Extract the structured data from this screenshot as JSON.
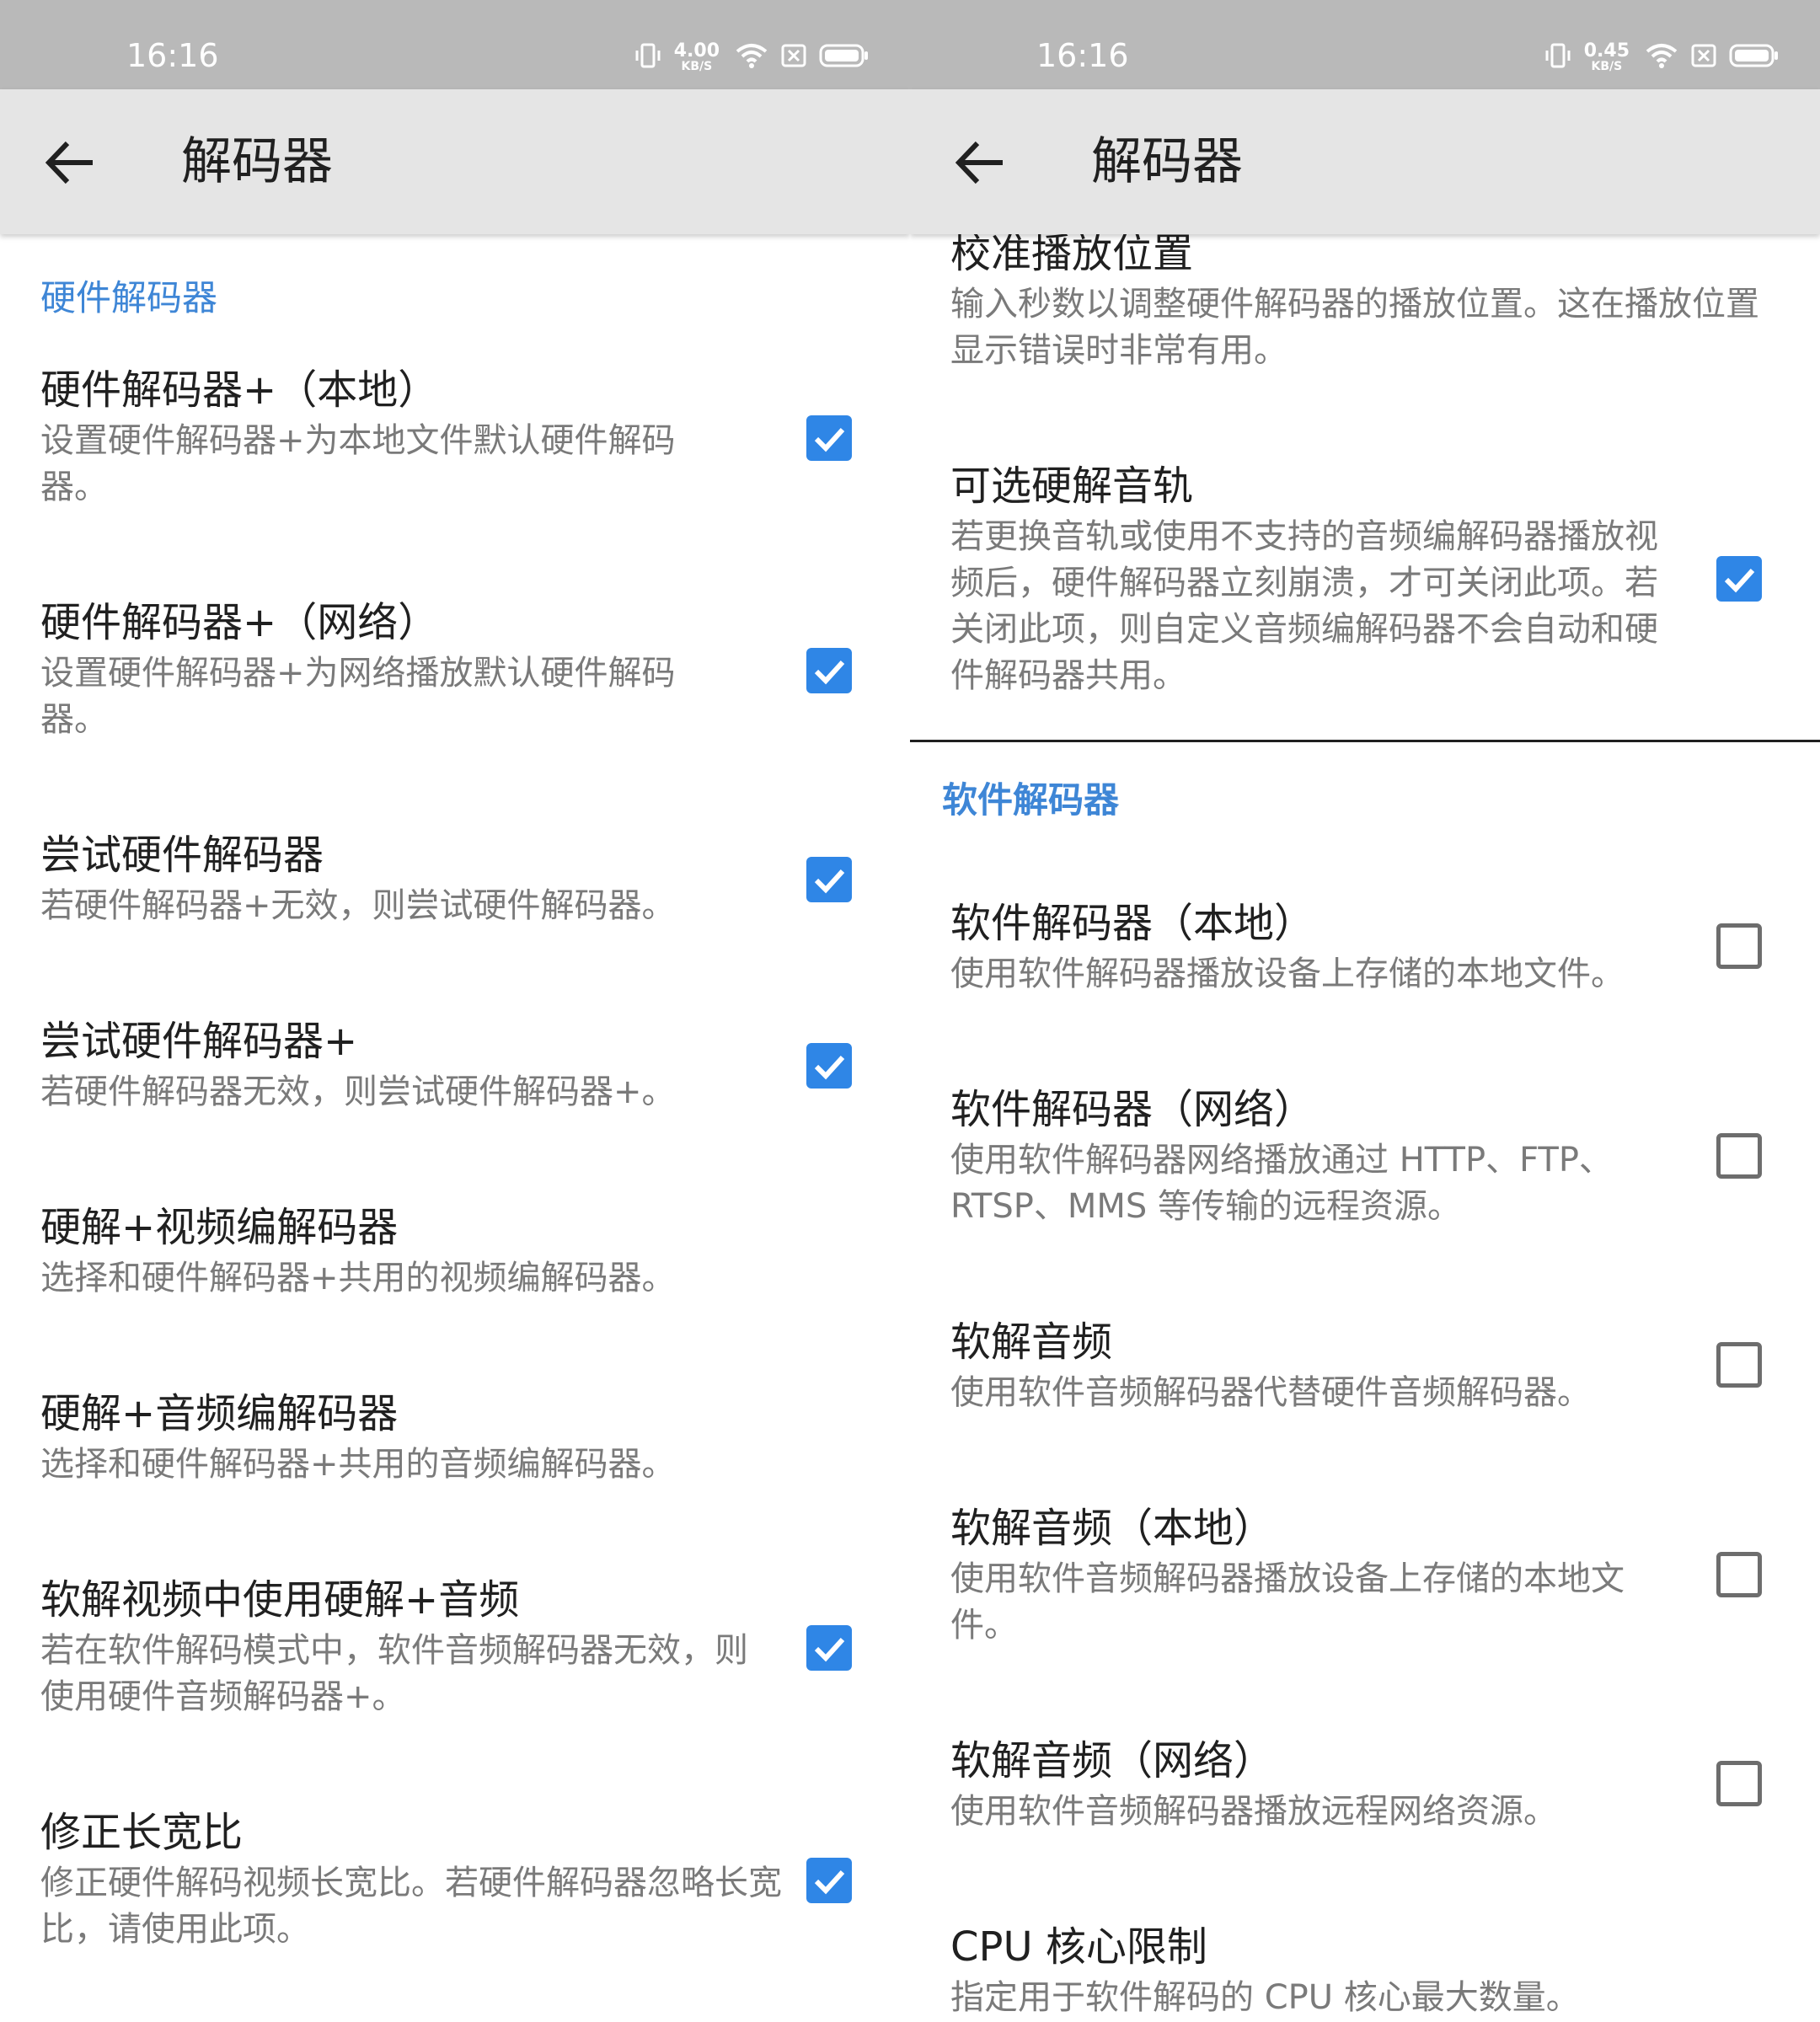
{
  "left": {
    "status_bar": {
      "time": "16:16",
      "speed_value": "4.00",
      "speed_unit": "KB/S"
    },
    "toolbar": {
      "title": "解码器"
    },
    "section_header": "硬件解码器",
    "prefs": [
      {
        "title": "硬件解码器+（本地）",
        "summary": "设置硬件解码器+为本地文件默认硬件解码器。",
        "checked": true
      },
      {
        "title": "硬件解码器+（网络）",
        "summary": "设置硬件解码器+为网络播放默认硬件解码器。",
        "checked": true
      },
      {
        "title": "尝试硬件解码器",
        "summary": "若硬件解码器+无效，则尝试硬件解码器。",
        "checked": true
      },
      {
        "title": "尝试硬件解码器+",
        "summary": "若硬件解码器无效，则尝试硬件解码器+。",
        "checked": true
      },
      {
        "title": "硬解+视频编解码器",
        "summary": "选择和硬件解码器+共用的视频编解码器。"
      },
      {
        "title": "硬解+音频编解码器",
        "summary": "选择和硬件解码器+共用的音频编解码器。"
      },
      {
        "title": "软解视频中使用硬解+音频",
        "summary": "若在软件解码模式中，软件音频解码器无效，则使用硬件音频解码器+。",
        "checked": true
      },
      {
        "title": "修正长宽比",
        "summary": "修正硬件解码视频长宽比。若硬件解码器忽略长宽比，请使用此项。",
        "checked": true
      }
    ]
  },
  "right": {
    "status_bar": {
      "time": "16:16",
      "speed_value": "0.45",
      "speed_unit": "KB/S"
    },
    "toolbar": {
      "title": "解码器"
    },
    "prefs_top": [
      {
        "title": "校准播放位置",
        "summary": "输入秒数以调整硬件解码器的播放位置。这在播放位置显示错误时非常有用。"
      },
      {
        "title": "可选硬解音轨",
        "summary": "若更换音轨或使用不支持的音频编解码器播放视频后，硬件解码器立刻崩溃，才可关闭此项。若关闭此项，则自定义音频编解码器不会自动和硬件解码器共用。",
        "checked": true
      }
    ],
    "section_header": "软件解码器",
    "prefs": [
      {
        "title": "软件解码器（本地）",
        "summary": "使用软件解码器播放设备上存储的本地文件。",
        "checked": false
      },
      {
        "title": "软件解码器（网络）",
        "summary": "使用软件解码器网络播放通过 HTTP、FTP、RTSP、MMS 等传输的远程资源。",
        "checked": false
      },
      {
        "title": "软解音频",
        "summary": "使用软件音频解码器代替硬件音频解码器。",
        "checked": false
      },
      {
        "title": "软解音频（本地）",
        "summary": "使用软件音频解码器播放设备上存储的本地文件。",
        "checked": false
      },
      {
        "title": "软解音频（网络）",
        "summary": "使用软件音频解码器播放远程网络资源。",
        "checked": false
      },
      {
        "title": "CPU 核心限制",
        "summary": "指定用于软件解码的 CPU 核心最大数量。"
      }
    ]
  },
  "icons": {
    "back": "arrow-left-icon",
    "vibrate": "vibrate-icon",
    "wifi": "wifi-icon",
    "sim": "no-sim-icon",
    "battery": "battery-icon",
    "check": "checkmark-icon"
  },
  "colors": {
    "accent": "#2f86e6",
    "section_header": "#3e86d6",
    "status_bar": "#b9b9b9",
    "toolbar": "#e5e5e5",
    "title_text": "#202020",
    "summary_text": "#7a7a7a"
  }
}
